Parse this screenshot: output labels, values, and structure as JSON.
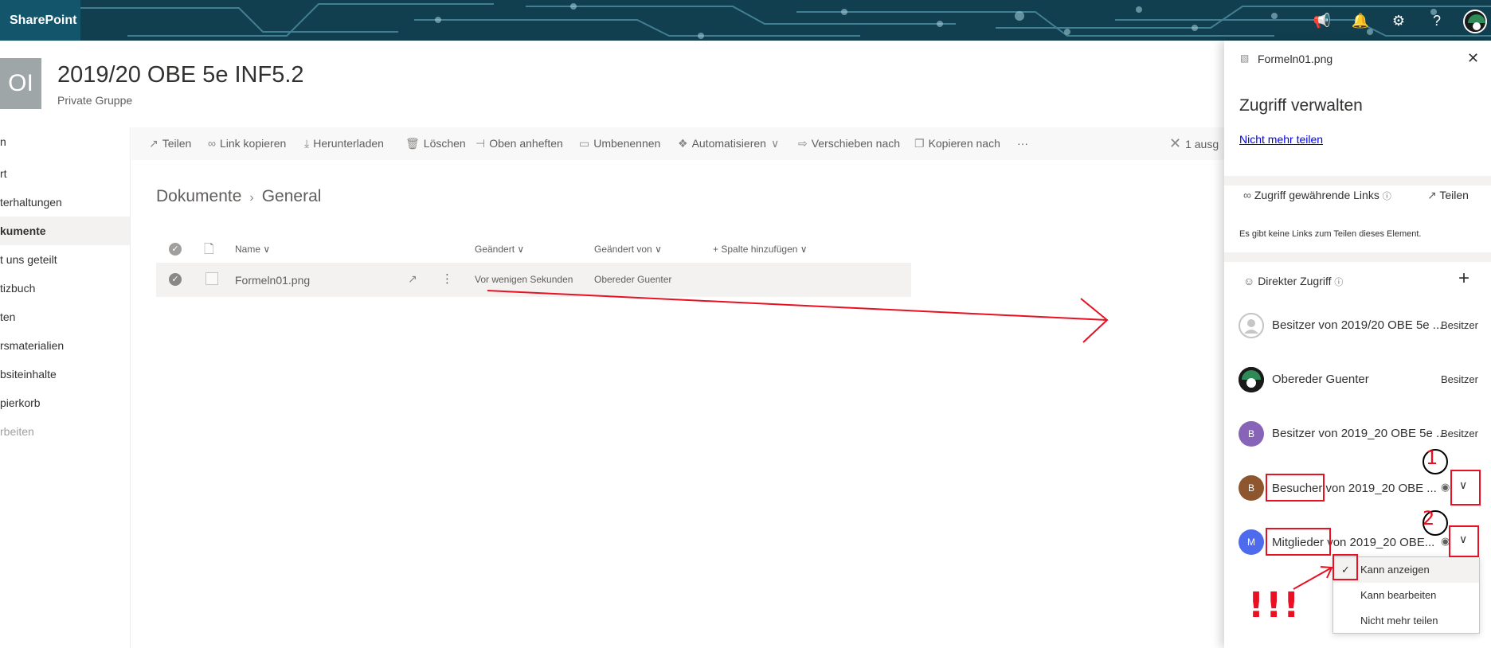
{
  "suite": {
    "brand": "SharePoint",
    "icons": [
      "megaphone-icon",
      "bell-icon",
      "gear-icon",
      "help-icon"
    ]
  },
  "site": {
    "logo_text": "OI",
    "title": "2019/20 OBE 5e INF5.2",
    "subtitle": "Private Gruppe"
  },
  "leftnav": {
    "items": [
      {
        "label": "n"
      },
      {
        "label": "rt"
      },
      {
        "label": "terhaltungen"
      },
      {
        "label": "kumente"
      },
      {
        "label": "t uns geteilt"
      },
      {
        "label": "tizbuch"
      },
      {
        "label": "ten"
      },
      {
        "label": "rsmaterialien"
      },
      {
        "label": "bsiteinhalte"
      },
      {
        "label": "pierkorb"
      },
      {
        "label": "rbeiten"
      }
    ]
  },
  "commandbar": {
    "share": "Teilen",
    "copy_link": "Link kopieren",
    "download": "Herunterladen",
    "delete": "Löschen",
    "pin": "Oben anheften",
    "rename": "Umbenennen",
    "automate": "Automatisieren",
    "move": "Verschieben nach",
    "copy": "Kopieren nach",
    "more": "···",
    "selected": "1 ausg"
  },
  "breadcrumb": {
    "root": "Dokumente",
    "current": "General"
  },
  "list": {
    "headers": {
      "name": "Name",
      "modified": "Geändert",
      "modified_by": "Geändert von",
      "add_column": "Spalte hinzufügen"
    },
    "rows": [
      {
        "name": "Formeln01.png",
        "modified": "Vor wenigen Sekunden",
        "modified_by": "Obereder Guenter"
      }
    ]
  },
  "panel": {
    "file_name": "Formeln01.png",
    "title": "Zugriff verwalten",
    "stop_sharing": "Nicht mehr teilen",
    "links_section": "Zugriff gewährende Links",
    "share": "Teilen",
    "no_links": "Es gibt keine Links zum Teilen dieses Element.",
    "direct_access": "Direkter Zugriff",
    "entries": [
      {
        "initial": "",
        "name": "Besitzer von 2019/20 OBE 5e ...",
        "role": "Besitzer",
        "color": "#c8c6c4"
      },
      {
        "initial": "",
        "name": "Obereder Guenter",
        "role": "Besitzer",
        "color": "#1a1a1a"
      },
      {
        "initial": "B",
        "name": "Besitzer von 2019_20 OBE 5e ...",
        "role": "Besitzer",
        "color": "#8764b8"
      },
      {
        "initial": "B",
        "name": "Besucher von 2019_20 OBE ...",
        "role": "",
        "color": "#8e562e"
      },
      {
        "initial": "M",
        "name": "Mitglieder von 2019_20 OBE...",
        "role": "",
        "color": "#4f6bed"
      }
    ],
    "menu": {
      "items": [
        "Kann anzeigen",
        "Kann bearbeiten",
        "Nicht mehr teilen"
      ],
      "selected_index": 0
    }
  },
  "annotations": {
    "num1": "1",
    "num2": "2",
    "exclaim": "!!!",
    "color": "#e81123"
  }
}
